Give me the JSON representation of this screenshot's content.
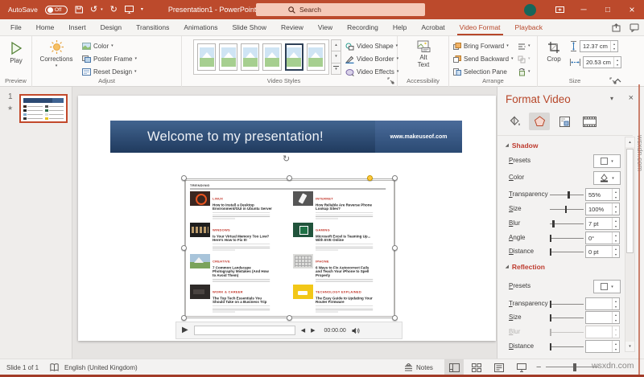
{
  "window": {
    "autosave_label": "AutoSave",
    "autosave_state": "Off",
    "title": "Presentation1 - PowerPoint",
    "search_placeholder": "Search"
  },
  "tabs": {
    "items": [
      "File",
      "Home",
      "Insert",
      "Design",
      "Transitions",
      "Animations",
      "Slide Show",
      "Review",
      "View",
      "Recording",
      "Help",
      "Acrobat",
      "Video Format",
      "Playback"
    ]
  },
  "ribbon": {
    "preview": {
      "play": "Play",
      "group": "Preview"
    },
    "adjust": {
      "corrections": "Corrections",
      "color": "Color",
      "poster_frame": "Poster Frame",
      "reset_design": "Reset Design",
      "group": "Adjust"
    },
    "styles": {
      "video_shape": "Video Shape",
      "video_border": "Video Border",
      "video_effects": "Video Effects",
      "group": "Video Styles"
    },
    "accessibility": {
      "alt_text": "Alt Text",
      "group": "Accessibility"
    },
    "arrange": {
      "bring_forward": "Bring Forward",
      "send_backward": "Send Backward",
      "selection_pane": "Selection Pane",
      "group": "Arrange"
    },
    "size": {
      "crop": "Crop",
      "height": "12.37 cm",
      "width": "20.53 cm",
      "group": "Size"
    }
  },
  "thumbnails": {
    "slide_number": "1"
  },
  "slide": {
    "banner": {
      "title": "Welcome to my presentation!",
      "url": "www.makeuseof.com"
    },
    "video": {
      "header": "TRENDING",
      "articles": [
        {
          "category": "LINUX",
          "title": "How to Install a Desktop Environment/GUI in Ubuntu Server"
        },
        {
          "category": "INTERNET",
          "title": "How Reliable Are Reverse Phone Lookup Sites?"
        },
        {
          "category": "WINDOWS",
          "title": "Is Your Virtual Memory Too Low? Here's How to Fix It!"
        },
        {
          "category": "GAMING",
          "title": "Microsoft Excel Is Teaming Up... With EVE Online"
        },
        {
          "category": "CREATIVE",
          "title": "7 Common Landscape Photography Mistakes (And How to Avoid Them)"
        },
        {
          "category": "IPHONE",
          "title": "6 Ways to Fix Autocorrect Fails and Teach Your iPhone to Spell Properly"
        },
        {
          "category": "WORK & CAREER",
          "title": "The Top Tech Essentials You Should Take on a Business Trip"
        },
        {
          "category": "TECHNOLOGY EXPLAINED",
          "title": "The Easy Guide to Updating Your Router Firmware"
        }
      ],
      "controls": {
        "time": "00:00.00"
      }
    }
  },
  "panel": {
    "title": "Format Video",
    "shadow": {
      "heading": "Shadow",
      "presets": "Presets",
      "color": "Color",
      "transparency": {
        "label": "Transparency",
        "value": "55%",
        "pct": 55
      },
      "size": {
        "label": "Size",
        "value": "100%",
        "pct": 47
      },
      "blur": {
        "label": "Blur",
        "value": "7 pt",
        "pct": 10
      },
      "angle": {
        "label": "Angle",
        "value": "0°",
        "pct": 2
      },
      "distance": {
        "label": "Distance",
        "value": "0 pt",
        "pct": 2
      }
    },
    "reflection": {
      "heading": "Reflection",
      "presets": "Presets",
      "transparency": {
        "label": "Transparency",
        "value": "",
        "pct": 2
      },
      "size": {
        "label": "Size",
        "value": "",
        "pct": 2
      },
      "blur": {
        "label": "Blur",
        "value": "",
        "pct": 2
      },
      "distance": {
        "label": "Distance",
        "value": "",
        "pct": 2
      }
    }
  },
  "statusbar": {
    "slide_label": "Slide 1 of 1",
    "language": "English (United Kingdom)",
    "notes": "Notes"
  },
  "watermark": {
    "text": "wsxdn.com"
  },
  "colors": {
    "accent": "#B7472A",
    "titlebar": "#BC4A2C",
    "panel_heading": "#BE3B2F"
  }
}
